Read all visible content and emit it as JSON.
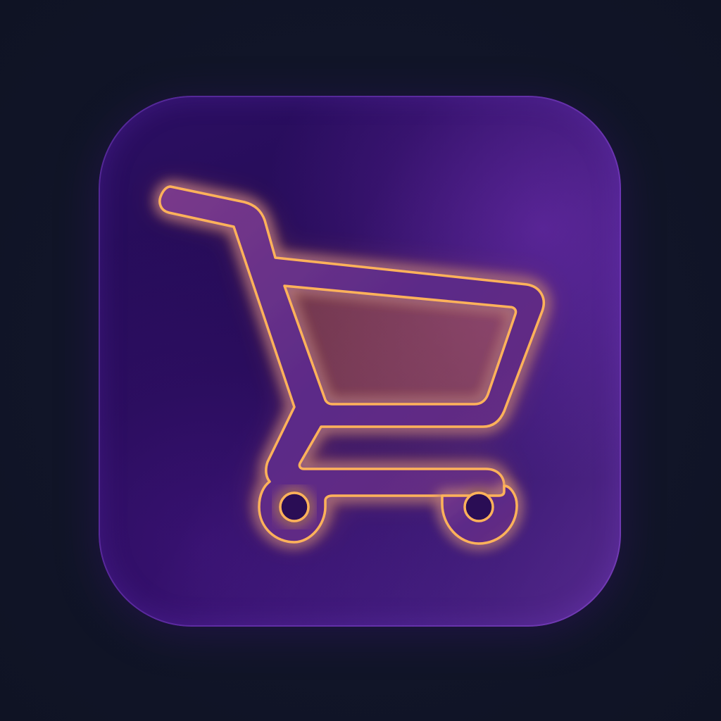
{
  "icon": {
    "name": "shopping-cart-icon",
    "colors": {
      "background": "#111528",
      "tile_top": "#2c0f63",
      "tile_bottom": "#220a52",
      "tile_rim": "#8a3fd6",
      "cart_fill": "#5a2a8a",
      "cart_outline": "#ffb25a",
      "glow": "#ff9a3c"
    }
  }
}
